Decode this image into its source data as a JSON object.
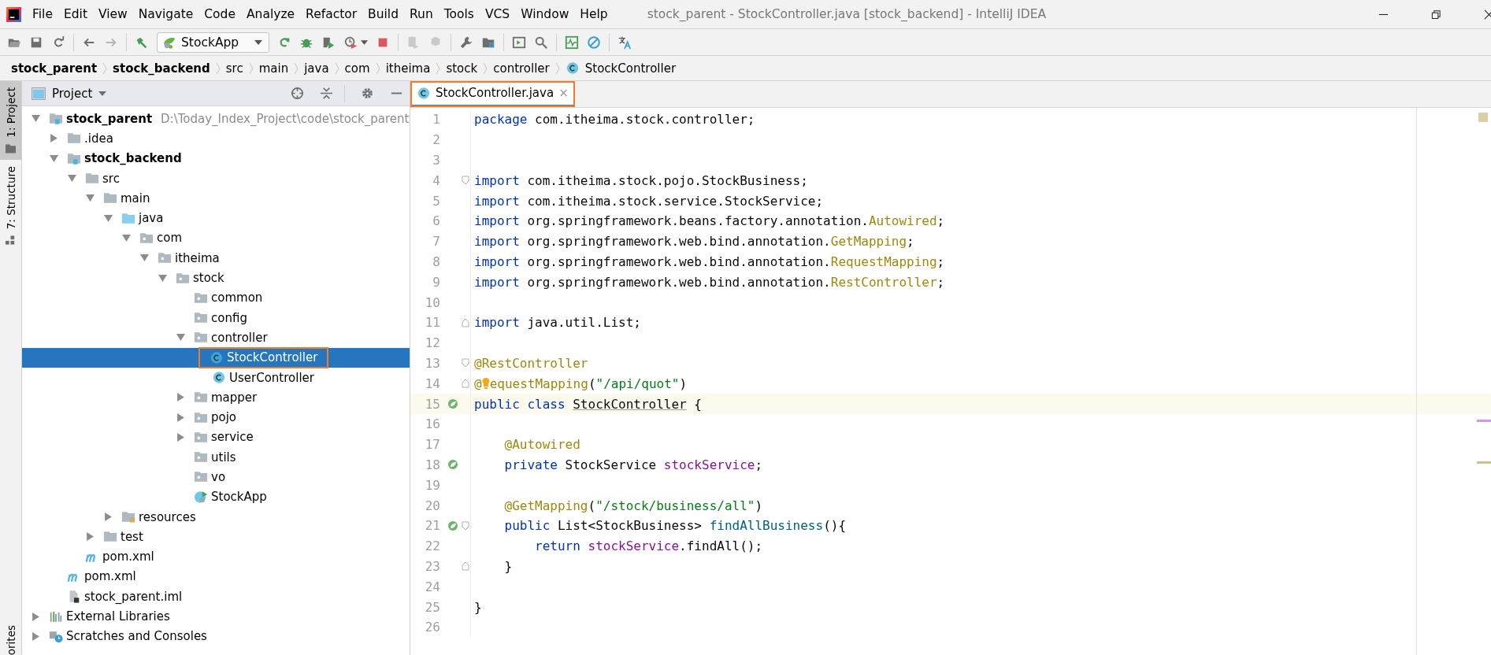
{
  "window": {
    "title": "stock_parent - StockController.java [stock_backend] - IntelliJ IDEA"
  },
  "menu": [
    "File",
    "Edit",
    "View",
    "Navigate",
    "Code",
    "Analyze",
    "Refactor",
    "Build",
    "Run",
    "Tools",
    "VCS",
    "Window",
    "Help"
  ],
  "toolbar": [
    {
      "kind": "open",
      "disabled": false
    },
    {
      "kind": "save",
      "disabled": false
    },
    {
      "kind": "sync",
      "disabled": false
    },
    {
      "kind": "sep"
    },
    {
      "kind": "back",
      "disabled": false
    },
    {
      "kind": "forward",
      "disabled": true
    },
    {
      "kind": "sep"
    },
    {
      "kind": "build",
      "disabled": false
    },
    {
      "kind": "config",
      "label": "StockApp"
    },
    {
      "kind": "rerun",
      "disabled": false
    },
    {
      "kind": "debug",
      "disabled": false
    },
    {
      "kind": "coverage",
      "disabled": false
    },
    {
      "kind": "profile",
      "disabled": false
    },
    {
      "kind": "stop",
      "disabled": false
    },
    {
      "kind": "sep"
    },
    {
      "kind": "attach",
      "disabled": true
    },
    {
      "kind": "deploy",
      "disabled": true
    },
    {
      "kind": "sep"
    },
    {
      "kind": "wrench",
      "disabled": false
    },
    {
      "kind": "structure",
      "disabled": false
    },
    {
      "kind": "sep"
    },
    {
      "kind": "terminal",
      "disabled": false
    },
    {
      "kind": "search",
      "disabled": false
    },
    {
      "kind": "sep"
    },
    {
      "kind": "monitor",
      "disabled": false
    },
    {
      "kind": "forbid",
      "disabled": false
    },
    {
      "kind": "sep"
    },
    {
      "kind": "translate",
      "disabled": false
    }
  ],
  "breadcrumbs": [
    {
      "label": "stock_parent",
      "bold": true,
      "kind": "folder"
    },
    {
      "label": "stock_backend",
      "bold": true,
      "kind": "folder"
    },
    {
      "label": "src",
      "bold": false,
      "kind": "folder"
    },
    {
      "label": "main",
      "bold": false,
      "kind": "folder"
    },
    {
      "label": "java",
      "bold": false,
      "kind": "folder"
    },
    {
      "label": "com",
      "bold": false,
      "kind": "folder"
    },
    {
      "label": "itheima",
      "bold": false,
      "kind": "folder"
    },
    {
      "label": "stock",
      "bold": false,
      "kind": "folder"
    },
    {
      "label": "controller",
      "bold": false,
      "kind": "folder"
    },
    {
      "label": "StockController",
      "bold": false,
      "kind": "class"
    }
  ],
  "side_tabs": [
    {
      "label": "1: Project",
      "selected": true,
      "kind": "project"
    },
    {
      "label": "7: Structure",
      "selected": false,
      "kind": "structure"
    }
  ],
  "side_tabs_bottom": [
    {
      "label": "orites"
    }
  ],
  "project_panel": {
    "title": "Project"
  },
  "tree": [
    {
      "label": "stock_parent",
      "kind": "module",
      "bold": true,
      "hint": "D:\\Today_Index_Project\\code\\stock_parent",
      "selected": false,
      "expanded": true,
      "children": [
        {
          "label": ".idea",
          "kind": "folder",
          "bold": false,
          "selected": false,
          "expanded": false
        },
        {
          "label": "stock_backend",
          "kind": "module",
          "bold": true,
          "selected": false,
          "expanded": true,
          "children": [
            {
              "label": "src",
              "kind": "folder",
              "bold": false,
              "selected": false,
              "expanded": true,
              "children": [
                {
                  "label": "main",
                  "kind": "folder",
                  "bold": false,
                  "selected": false,
                  "expanded": true,
                  "children": [
                    {
                      "label": "java",
                      "kind": "source",
                      "bold": false,
                      "selected": false,
                      "expanded": true,
                      "children": [
                        {
                          "label": "com",
                          "kind": "package",
                          "bold": false,
                          "selected": false,
                          "expanded": true,
                          "children": [
                            {
                              "label": "itheima",
                              "kind": "package",
                              "bold": false,
                              "selected": false,
                              "expanded": true,
                              "children": [
                                {
                                  "label": "stock",
                                  "kind": "package",
                                  "bold": false,
                                  "selected": false,
                                  "expanded": true,
                                  "children": [
                                    {
                                      "label": "common",
                                      "kind": "package",
                                      "bold": false,
                                      "selected": false
                                    },
                                    {
                                      "label": "config",
                                      "kind": "package",
                                      "bold": false,
                                      "selected": false
                                    },
                                    {
                                      "label": "controller",
                                      "kind": "package",
                                      "bold": false,
                                      "selected": false,
                                      "expanded": true,
                                      "children": [
                                        {
                                          "label": "StockController",
                                          "kind": "class",
                                          "bold": false,
                                          "selected": true,
                                          "annotated": true
                                        },
                                        {
                                          "label": "UserController",
                                          "kind": "class",
                                          "bold": false,
                                          "selected": false
                                        }
                                      ]
                                    },
                                    {
                                      "label": "mapper",
                                      "kind": "package",
                                      "bold": false,
                                      "selected": false,
                                      "expanded": false
                                    },
                                    {
                                      "label": "pojo",
                                      "kind": "package",
                                      "bold": false,
                                      "selected": false,
                                      "expanded": false
                                    },
                                    {
                                      "label": "service",
                                      "kind": "package",
                                      "bold": false,
                                      "selected": false,
                                      "expanded": false
                                    },
                                    {
                                      "label": "utils",
                                      "kind": "package",
                                      "bold": false,
                                      "selected": false
                                    },
                                    {
                                      "label": "vo",
                                      "kind": "package",
                                      "bold": false,
                                      "selected": false
                                    },
                                    {
                                      "label": "StockApp",
                                      "kind": "app",
                                      "bold": false,
                                      "selected": false
                                    }
                                  ]
                                }
                              ]
                            }
                          ]
                        }
                      ]
                    },
                    {
                      "label": "resources",
                      "kind": "resources",
                      "bold": false,
                      "selected": false,
                      "expanded": false
                    }
                  ]
                },
                {
                  "label": "test",
                  "kind": "folder",
                  "bold": false,
                  "selected": false,
                  "expanded": false
                }
              ]
            },
            {
              "label": "pom.xml",
              "kind": "maven",
              "bold": false,
              "selected": false
            }
          ]
        },
        {
          "label": "pom.xml",
          "kind": "maven",
          "bold": false,
          "selected": false
        },
        {
          "label": "stock_parent.iml",
          "kind": "iml",
          "bold": false,
          "selected": false
        }
      ]
    },
    {
      "label": "External Libraries",
      "kind": "libraries",
      "bold": false,
      "selected": false,
      "expanded": false
    },
    {
      "label": "Scratches and Consoles",
      "kind": "scratches",
      "bold": false,
      "selected": false,
      "expanded": false
    }
  ],
  "editor": {
    "tabs": [
      {
        "label": "StockController.java",
        "close": "×",
        "selected": true,
        "annotated": true
      }
    ],
    "lines": [
      {
        "n": "1",
        "tokens": [
          {
            "kind": "kw",
            "t": "package"
          },
          {
            "kind": "plain",
            "t": " com.itheima.stock.controller;"
          }
        ]
      },
      {
        "n": "2"
      },
      {
        "n": "3"
      },
      {
        "n": "4",
        "gutter": [
          {
            "kind": "fold"
          }
        ],
        "tokens": [
          {
            "kind": "kw",
            "t": "import"
          },
          {
            "kind": "plain",
            "t": " com.itheima.stock.pojo.StockBusiness;"
          }
        ]
      },
      {
        "n": "5",
        "tokens": [
          {
            "kind": "kw",
            "t": "import"
          },
          {
            "kind": "plain",
            "t": " com.itheima.stock.service.StockService;"
          }
        ]
      },
      {
        "n": "6",
        "tokens": [
          {
            "kind": "kw",
            "t": "import"
          },
          {
            "kind": "plain",
            "t": " org.springframework.beans.factory.annotation."
          },
          {
            "kind": "ann",
            "t": "Autowired"
          },
          {
            "kind": "plain",
            "t": ";"
          }
        ]
      },
      {
        "n": "7",
        "tokens": [
          {
            "kind": "kw",
            "t": "import"
          },
          {
            "kind": "plain",
            "t": " org.springframework.web.bind.annotation."
          },
          {
            "kind": "ann",
            "t": "GetMapping"
          },
          {
            "kind": "plain",
            "t": ";"
          }
        ]
      },
      {
        "n": "8",
        "tokens": [
          {
            "kind": "kw",
            "t": "import"
          },
          {
            "kind": "plain",
            "t": " org.springframework.web.bind.annotation."
          },
          {
            "kind": "ann",
            "t": "RequestMapping"
          },
          {
            "kind": "plain",
            "t": ";"
          }
        ]
      },
      {
        "n": "9",
        "tokens": [
          {
            "kind": "kw",
            "t": "import"
          },
          {
            "kind": "plain",
            "t": " org.springframework.web.bind.annotation."
          },
          {
            "kind": "ann",
            "t": "RestController"
          },
          {
            "kind": "plain",
            "t": ";"
          }
        ]
      },
      {
        "n": "10"
      },
      {
        "n": "11",
        "gutter": [
          {
            "kind": "fold-end"
          }
        ],
        "tokens": [
          {
            "kind": "kw",
            "t": "import"
          },
          {
            "kind": "plain",
            "t": " java.util.List;"
          }
        ]
      },
      {
        "n": "12"
      },
      {
        "n": "13",
        "gutter": [
          {
            "kind": "fold"
          }
        ],
        "tokens": [
          {
            "kind": "ann",
            "t": "@RestController"
          }
        ]
      },
      {
        "n": "14",
        "gutter": [
          {
            "kind": "fold-end"
          }
        ],
        "tokens": [
          {
            "kind": "ann",
            "t": "@"
          },
          {
            "kind": "bulb"
          },
          {
            "kind": "ann",
            "t": "equestMapping"
          },
          {
            "kind": "plain",
            "t": "("
          },
          {
            "kind": "str",
            "t": "\"/api/quot\""
          },
          {
            "kind": "plain",
            "t": ")"
          }
        ]
      },
      {
        "n": "15",
        "current": true,
        "gutter": [
          {
            "kind": "bean"
          }
        ],
        "tokens": [
          {
            "kind": "kw",
            "t": "public class "
          },
          {
            "kind": "usage",
            "t": "StockController"
          },
          {
            "kind": "plain",
            "t": " {"
          }
        ]
      },
      {
        "n": "16"
      },
      {
        "n": "17",
        "tokens": [
          {
            "kind": "ann",
            "t": "    @Autowired"
          }
        ]
      },
      {
        "n": "18",
        "gutter": [
          {
            "kind": "bean"
          }
        ],
        "tokens": [
          {
            "kind": "kw",
            "t": "    private "
          },
          {
            "kind": "plain",
            "t": "StockService "
          },
          {
            "kind": "field",
            "t": "stockService"
          },
          {
            "kind": "plain",
            "t": ";"
          }
        ]
      },
      {
        "n": "19"
      },
      {
        "n": "20",
        "tokens": [
          {
            "kind": "ann",
            "t": "    @GetMapping"
          },
          {
            "kind": "plain",
            "t": "("
          },
          {
            "kind": "str",
            "t": "\"/stock/business/all\""
          },
          {
            "kind": "plain",
            "t": ")"
          }
        ]
      },
      {
        "n": "21",
        "gutter": [
          {
            "kind": "bean"
          },
          {
            "kind": "fold"
          }
        ],
        "tokens": [
          {
            "kind": "kw",
            "t": "    public "
          },
          {
            "kind": "plain",
            "t": "List<StockBusiness> "
          },
          {
            "kind": "fn",
            "t": "findAllBusiness"
          },
          {
            "kind": "plain",
            "t": "(){"
          }
        ]
      },
      {
        "n": "22",
        "tokens": [
          {
            "kind": "kw",
            "t": "        return "
          },
          {
            "kind": "field",
            "t": "stockService"
          },
          {
            "kind": "plain",
            "t": ".findAll();"
          }
        ]
      },
      {
        "n": "23",
        "gutter": [
          {
            "kind": "fold-end"
          }
        ],
        "tokens": [
          {
            "kind": "plain",
            "t": "    }"
          }
        ]
      },
      {
        "n": "24"
      },
      {
        "n": "25",
        "tokens": [
          {
            "kind": "plain",
            "t": "}"
          }
        ]
      },
      {
        "n": "26"
      }
    ]
  }
}
